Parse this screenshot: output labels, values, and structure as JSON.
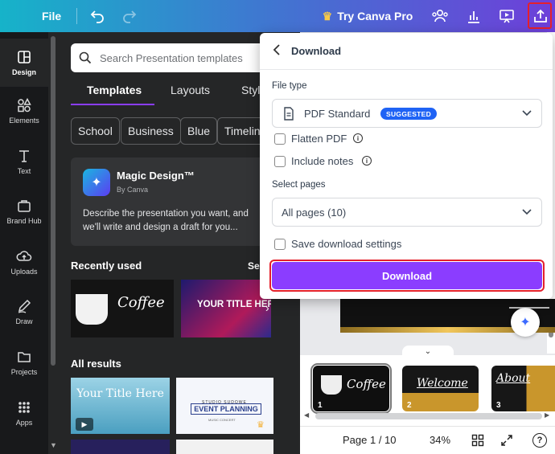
{
  "topbar": {
    "file_label": "File",
    "try_pro_label": "Try Canva Pro",
    "accent_gradient": [
      "#16b3c9",
      "#6e3fd9"
    ],
    "icons": [
      "undo-icon",
      "redo-icon",
      "crown-icon",
      "share-people-icon",
      "analytics-icon",
      "present-icon",
      "export-icon"
    ]
  },
  "rail": {
    "items": [
      {
        "label": "Design",
        "icon": "design-icon"
      },
      {
        "label": "Elements",
        "icon": "elements-icon"
      },
      {
        "label": "Text",
        "icon": "text-icon"
      },
      {
        "label": "Brand Hub",
        "icon": "brand-hub-icon"
      },
      {
        "label": "Uploads",
        "icon": "uploads-icon"
      },
      {
        "label": "Draw",
        "icon": "draw-icon"
      },
      {
        "label": "Projects",
        "icon": "projects-icon"
      },
      {
        "label": "Apps",
        "icon": "apps-icon"
      }
    ]
  },
  "panel": {
    "search_placeholder": "Search Presentation templates",
    "tabs": [
      "Templates",
      "Layouts",
      "Styl"
    ],
    "chips": [
      "School",
      "Business",
      "Blue",
      "Timeline"
    ],
    "magic": {
      "title": "Magic Design™",
      "by": "By Canva",
      "desc": "Describe the presentation you want, and we'll write and design a draft for you..."
    },
    "recently_used": "Recently used",
    "see_all": "Se",
    "recent_thumbs": [
      "Coffee",
      "YOUR TITLE HERE"
    ],
    "all_results": "All results",
    "result_thumbs": {
      "your_title": "Your Title Here",
      "studio": "STUDIO SUDOWE",
      "event": "EVENT PLANNING",
      "music": "MUSIC CONCERT"
    }
  },
  "dialog": {
    "title": "Download",
    "file_type_label": "File type",
    "file_type_value": "PDF Standard",
    "suggested_badge": "SUGGESTED",
    "flatten_label": "Flatten PDF",
    "flatten_checked": false,
    "notes_label": "Include notes",
    "notes_checked": false,
    "select_pages_label": "Select pages",
    "select_pages_value": "All pages (10)",
    "save_settings_label": "Save download settings",
    "save_settings_checked": false,
    "download_button": "Download",
    "button_color": "#8b3dff"
  },
  "pages": {
    "thumbs": [
      {
        "num": "1",
        "title": "Coffee"
      },
      {
        "num": "2",
        "title": "Welcome"
      },
      {
        "num": "3",
        "title": "About"
      }
    ]
  },
  "bottom": {
    "page_indicator": "Page 1 / 10",
    "zoom": "34%",
    "help": "?"
  }
}
